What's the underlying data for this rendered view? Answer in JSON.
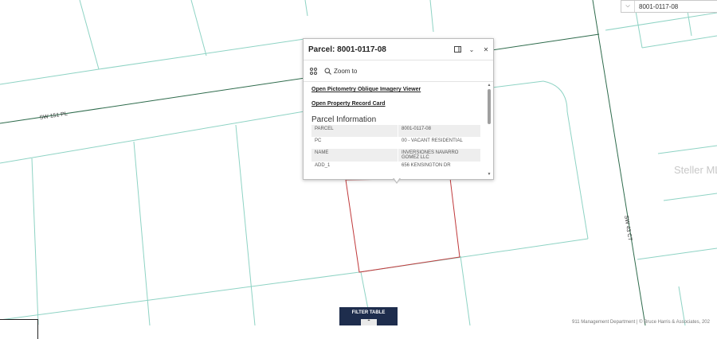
{
  "map": {
    "road_labels": [
      "SW 151 PL",
      "SW 43 CT"
    ],
    "watermark": "Steller MLS",
    "parcel_boundary_color": "#c0393b",
    "parcel_line_color": "#8ed3c4",
    "road_line_color": "#2e6b4c"
  },
  "search": {
    "value": "8001-0117-08"
  },
  "popup": {
    "title": "Parcel: 8001-0117-08",
    "zoom_label": "Zoom to",
    "links": [
      "Open Pictometry Oblique Imagery Viewer",
      "Open Property Record Card"
    ],
    "section_title": "Parcel Information",
    "rows": [
      {
        "key": "PARCEL",
        "value": "8001-0117-08"
      },
      {
        "key": "PC",
        "value": "00 - VACANT RESIDENTIAL"
      },
      {
        "key": "NAME",
        "value": "INVERSIONES NAVARRO GOMEZ LLC"
      },
      {
        "key": "ADD_1",
        "value": "656 KENSINGTON DR"
      }
    ]
  },
  "filter_table": {
    "label": "FILTER TABLE"
  },
  "attribution": "911 Management Department | © Bruce Harris & Associates, 202"
}
